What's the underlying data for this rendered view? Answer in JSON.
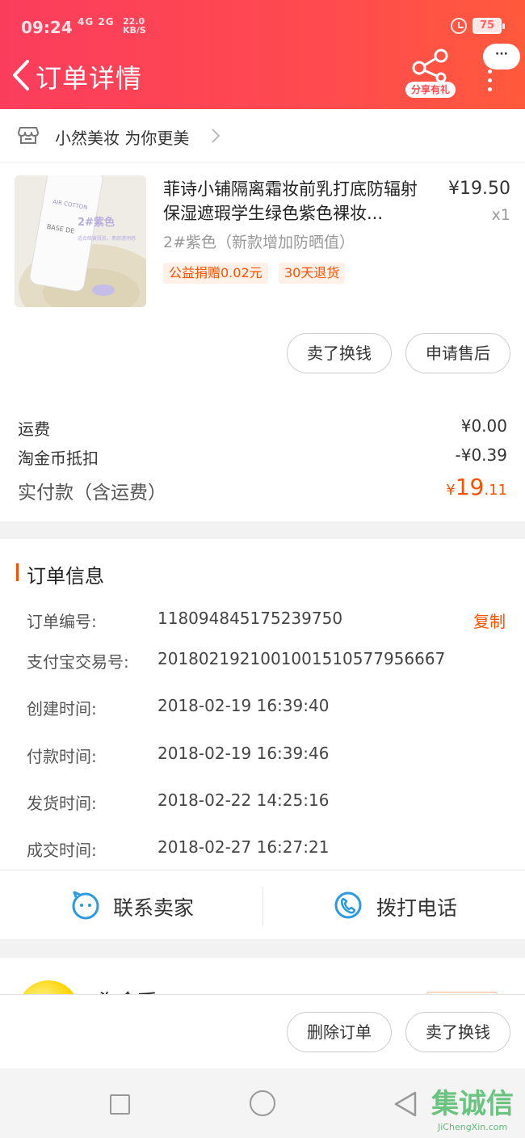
{
  "status_bar": {
    "time": "09:24",
    "signal": "4G 2G",
    "speed_value": "22.0",
    "speed_unit": "KB/S",
    "battery": "75"
  },
  "header": {
    "title": "订单详情",
    "share_label": "分享有礼",
    "more_label": "···"
  },
  "shop": {
    "name": "小然美妆 为你更美"
  },
  "product": {
    "title": "菲诗小铺隔离霜妆前乳打底防辐射保湿遮瑕学生绿色紫色裸妆...",
    "price": "¥19.50",
    "quantity": "x1",
    "sku": "2#紫色（新款增加防晒值）",
    "tags": [
      "公益捐赠0.02元",
      "30天退货"
    ],
    "image_texts": {
      "brand_line": "AIR COTTON",
      "base_label": "BASE DE",
      "variant": "2#紫色",
      "note": "适合暗黄肌肤，素颜透明感"
    }
  },
  "card_actions": {
    "sell": "卖了换钱",
    "after_sales": "申请售后"
  },
  "fees": {
    "shipping_label": "运费",
    "shipping_value": "¥0.00",
    "coin_label": "淘金币抵扣",
    "coin_value": "-¥0.39",
    "total_label": "实付款（含运费）",
    "total_currency": "¥",
    "total_int": "19",
    "total_dec": ".11"
  },
  "order_info": {
    "title": "订单信息",
    "copy_label": "复制",
    "rows": [
      {
        "label": "订单编号:",
        "value": "118094845175239750"
      },
      {
        "label": "支付宝交易号:",
        "value": "2018021921001001510577956667"
      },
      {
        "label": "创建时间:",
        "value": "2018-02-19 16:39:40"
      },
      {
        "label": "付款时间:",
        "value": "2018-02-19 16:39:46"
      },
      {
        "label": "发货时间:",
        "value": "2018-02-22 14:25:16"
      },
      {
        "label": "成交时间:",
        "value": "2018-02-27 16:27:21"
      }
    ]
  },
  "contact": {
    "seller": "联系卖家",
    "phone": "拨打电话"
  },
  "coin_peek": {
    "text": "淘金币"
  },
  "bottom_actions": {
    "delete": "删除订单",
    "sell": "卖了换钱"
  },
  "watermark": {
    "logo": "集诚信",
    "domain": "JiChengXin.com"
  },
  "colors": {
    "header_gradient": [
      "#fb3d5c",
      "#ff5a3c"
    ],
    "accent": "#ff5000"
  }
}
